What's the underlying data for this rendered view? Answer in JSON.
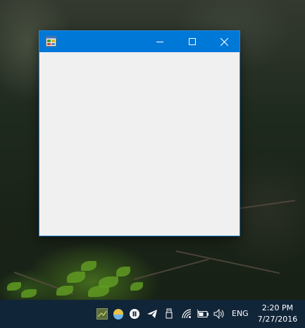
{
  "window": {
    "icon": "app-icon",
    "controls": {
      "minimize_icon": "minimize-icon",
      "maximize_icon": "maximize-icon",
      "close_icon": "close-icon"
    },
    "titlebar_color": "#0078d7",
    "client_color": "#f0f0f0"
  },
  "taskbar": {
    "background_color": "#112539",
    "tray_icons": [
      "app-tray-icon",
      "weather-icon",
      "media-icon",
      "telegram-icon",
      "usb-icon",
      "wifi-icon",
      "battery-icon",
      "volume-icon"
    ],
    "language": "ENG",
    "time": "2:20 PM",
    "date": "7/27/2016"
  }
}
